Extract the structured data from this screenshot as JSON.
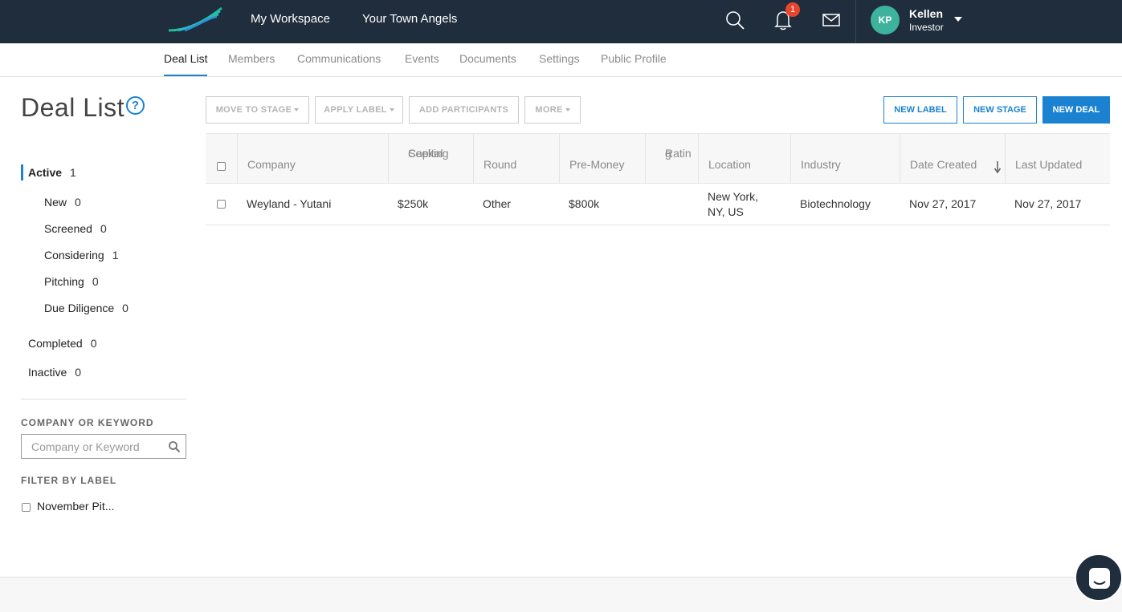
{
  "topbar": {
    "nav": [
      "My Workspace",
      "Your Town Angels"
    ],
    "notification_count": "1",
    "user": {
      "initials": "KP",
      "name": "Kellen",
      "role": "Investor"
    },
    "icons": [
      "logo-icon",
      "search-icon",
      "bell-icon",
      "mail-icon",
      "chevron-down-icon"
    ]
  },
  "subnav": {
    "tabs": [
      "Deal List",
      "Members",
      "Communications",
      "Events",
      "Documents",
      "Settings",
      "Public Profile"
    ],
    "active": "Deal List"
  },
  "sidebar": {
    "title": "Deal List",
    "help": "?",
    "active": {
      "label": "Active",
      "count": "1"
    },
    "stages": [
      {
        "label": "New",
        "count": "0"
      },
      {
        "label": "Screened",
        "count": "0"
      },
      {
        "label": "Considering",
        "count": "1"
      },
      {
        "label": "Pitching",
        "count": "0"
      },
      {
        "label": "Due Diligence",
        "count": "0"
      }
    ],
    "completed": {
      "label": "Completed",
      "count": "0"
    },
    "inactive": {
      "label": "Inactive",
      "count": "0"
    },
    "search_label": "COMPANY OR KEYWORD",
    "search_placeholder": "Company or Keyword",
    "filter_label": "FILTER BY LABEL",
    "labels": [
      "November Pit..."
    ]
  },
  "toolbar": {
    "move_to_stage": "MOVE TO STAGE",
    "apply_label": "APPLY LABEL",
    "add_participants": "ADD PARTICIPANTS",
    "more": "MORE",
    "new_label": "NEW LABEL",
    "new_stage": "NEW STAGE",
    "new_deal": "NEW DEAL"
  },
  "table": {
    "columns": [
      "Company",
      "Capital Seeking",
      "Round",
      "Pre-Money",
      "Rating",
      "Location",
      "Industry",
      "Date Created",
      "Last Updated"
    ],
    "column_lines": {
      "capital": [
        "Capital",
        "Seeking"
      ],
      "rating": [
        "Ratin",
        "g"
      ]
    },
    "sorted_by": "Date Created",
    "rows": [
      {
        "company": "Weyland - Yutani",
        "capital": "$250k",
        "round": "Other",
        "premoney": "$800k",
        "rating": "",
        "location_lines": [
          "New York,",
          "NY, US"
        ],
        "industry": "Biotechnology",
        "date_created": "Nov 27, 2017",
        "last_updated": "Nov 27, 2017"
      }
    ]
  },
  "colors": {
    "topbar": "#1f2d3d",
    "accent": "#1b82d1",
    "avatar": "#3db39e",
    "badge": "#e8452c"
  }
}
